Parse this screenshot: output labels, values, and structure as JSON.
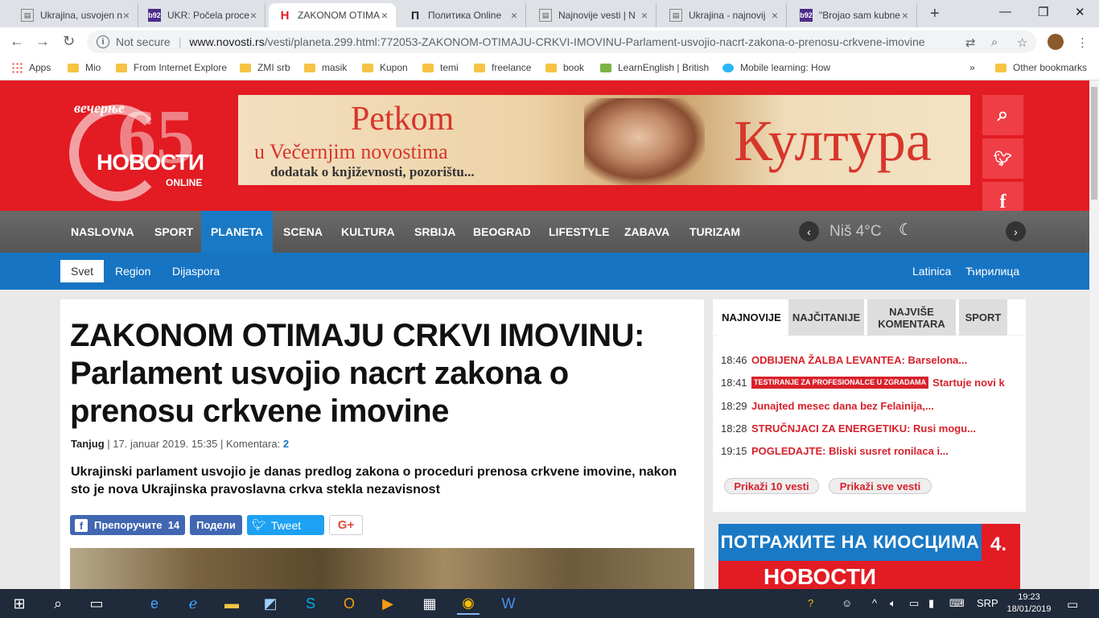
{
  "browser": {
    "tabs": [
      {
        "label": "Ukrajina, usvojen n",
        "favicon_color": "#5f6368",
        "favicon": "▤"
      },
      {
        "label": "UKR: Počela proce",
        "favicon_color": "#4b2c8a",
        "favicon": "b92"
      },
      {
        "label": "ZAKONOM OTIMA",
        "favicon_color": "#ffffff",
        "favicon": "H",
        "active": true
      },
      {
        "label": "Политика Online",
        "favicon_color": "#ffffff",
        "favicon": "Π"
      },
      {
        "label": "Najnovije vesti | N",
        "favicon_color": "#5f6368",
        "favicon": "▤"
      },
      {
        "label": "Ukrajina - najnovij",
        "favicon_color": "#5f6368",
        "favicon": "▤"
      },
      {
        "label": "\"Brojao sam kubne",
        "favicon_color": "#4b2c8a",
        "favicon": "b92"
      }
    ],
    "new_tab": "+",
    "security": "Not secure",
    "url_host": "www.novosti.rs",
    "url_path": "/vesti/planeta.299.html:772053-ZAKONOM-OTIMAJU-CRKVI-IMOVINU-Parlament-usvojio-nacrt-zakona-o-prenosu-crkvene-imovine",
    "bookmarks": [
      "Apps",
      "Mio",
      "From Internet Explore",
      "ZMI srb",
      "masik",
      "Kupon",
      "temi",
      "freelance",
      "book",
      "LearnEnglish | British",
      "Mobile learning: How"
    ],
    "other_bookmarks": "Other bookmarks",
    "more_bookmarks": "»"
  },
  "site": {
    "logo": {
      "top": "вечерње",
      "number": "65",
      "name": "НОВОСТИ",
      "sub": "ONLINE"
    },
    "banner": {
      "line1": "Petkom",
      "line2": "u Večernjim novostima",
      "line3": "dodatak o književnosti, pozorištu...",
      "brand": "Култура"
    },
    "main_nav": [
      "NASLOVNA",
      "SPORT",
      "PLANETA",
      "SCENA",
      "KULTURA",
      "SRBIJA",
      "BEOGRAD",
      "LIFESTYLE",
      "ZABAVA",
      "TURIZAM"
    ],
    "weather": {
      "city_temp": "Niš 4°C",
      "prev": "‹",
      "next": "›",
      "icon": "☾"
    },
    "sub_nav": [
      "Svet",
      "Region",
      "Dijaspora"
    ],
    "scripts": [
      "Latinica",
      "Ћирилица"
    ]
  },
  "article": {
    "headline": "ZAKONOM OTIMAJU CRKVI IMOVINU: Parlament usvojio nacrt zakona o prenosu crkvene imovine",
    "author": "Tanjug",
    "date": "| 17. januar 2019. 15:35 |",
    "comments_label": "Komentara:",
    "comments_count": "2",
    "lead": "Ukrajinski parlament usvojio je danas predlog zakona o proceduri prenosa crkvene imovine, nakon sto je nova Ukrajinska pravoslavna crkva stekla nezavisnost",
    "share": {
      "fb_like": "Препоручите",
      "fb_count": "14",
      "fb_share": "Подели",
      "tweet": "Tweet",
      "gplus": "G+"
    }
  },
  "sidebar": {
    "tabs": [
      "NAJNOVIJE",
      "NAJČITANIJE",
      "NAJVIŠE KOMENTARA",
      "SPORT"
    ],
    "news": [
      {
        "time": "18:46",
        "title": "ODBIJENA ŽALBA LEVANTEA: Barselona..."
      },
      {
        "time": "18:41",
        "tag": "TESTIRANJE ZA PROFESIONALCE U ZGRADAMA",
        "title": "Startuje novi k"
      },
      {
        "time": "18:29",
        "title": "Junajted mesec dana bez Felainija,..."
      },
      {
        "time": "18:28",
        "title": "STRUČNJACI ZA ENERGETIKU: Rusi mogu..."
      },
      {
        "time": "19:15",
        "title": "POGLEDAJTE: Bliski susret ronilaca i..."
      }
    ],
    "show_10": "Prikaži 10 vesti",
    "show_all": "Prikaži sve vesti",
    "ad": {
      "line1": "ПОТРАЖИТЕ НА КИОСЦИМА",
      "number": "4.",
      "name": "НОВОСТИ"
    }
  },
  "taskbar": {
    "lang": "SRP",
    "time": "19:23",
    "date": "18/01/2019"
  }
}
